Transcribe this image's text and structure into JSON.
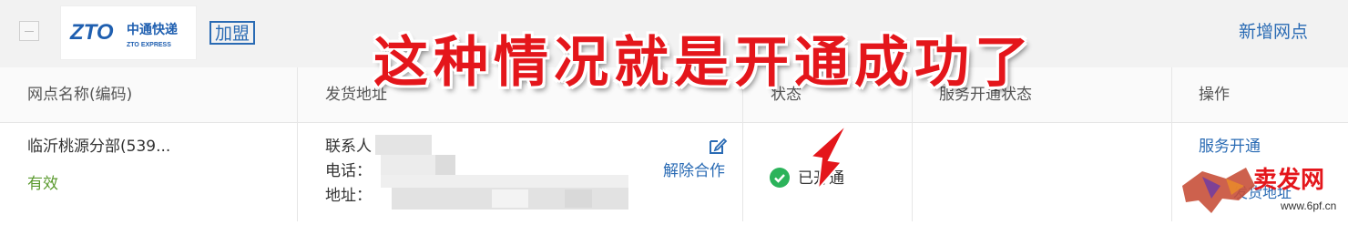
{
  "toolbar": {
    "logo_cn": "中通快递",
    "logo_en": "ZTO EXPRESS",
    "logo_mark": "ZTO",
    "join_label": "加盟",
    "add_site_label": "新增网点"
  },
  "overlay_caption": "这种情况就是开通成功了",
  "table": {
    "headers": [
      "网点名称(编码)",
      "发货地址",
      "状态",
      "服务开通状态",
      "操作"
    ],
    "rows": [
      {
        "site_name": "临沂桃源分部(539...",
        "valid_status": "有效",
        "contact_label": "联系人",
        "phone_label": "电话：",
        "address_label": "地址：",
        "end_cooperation": "解除合作",
        "status": "已开通",
        "action_service_open": "服务开通",
        "action_ship_address": "发货地址"
      }
    ]
  },
  "watermark": {
    "text": "卖发网",
    "url": "www.6pf.cn"
  },
  "colors": {
    "accent_blue": "#2a6bb4",
    "success_green": "#2bb35a",
    "valid_green": "#5b9a2f",
    "overlay_red": "#e4161b"
  }
}
